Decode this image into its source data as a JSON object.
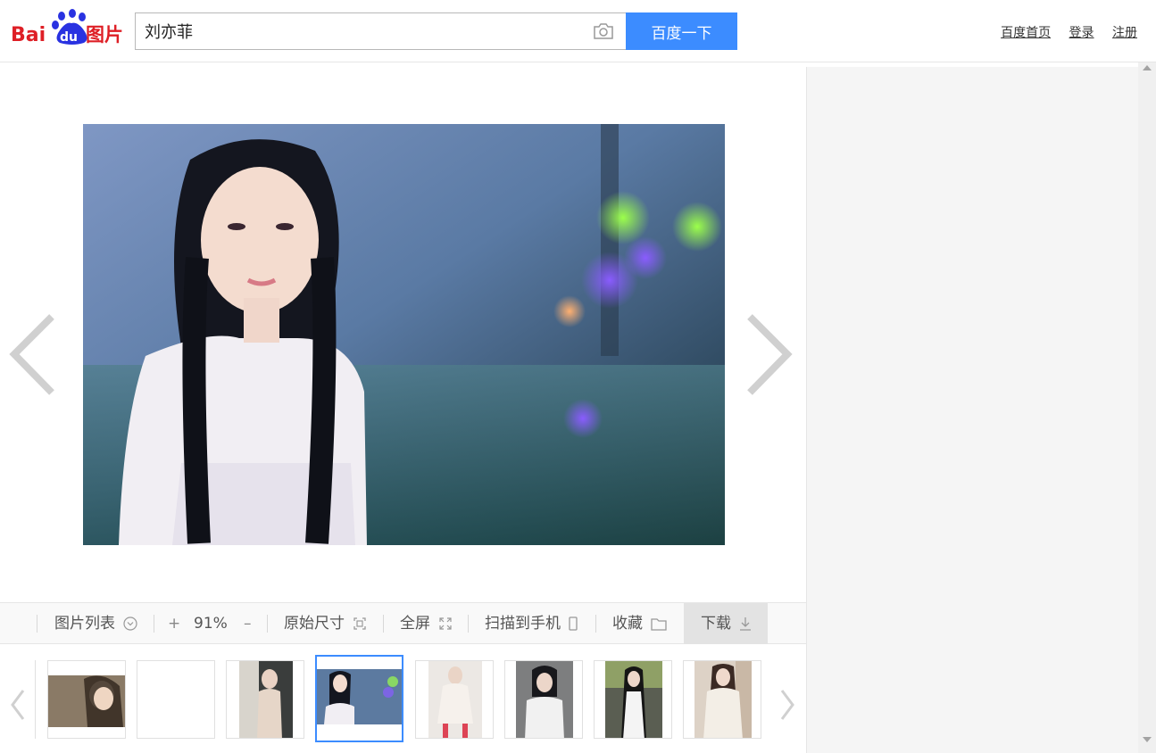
{
  "header": {
    "logo_text_bai": "Bai",
    "logo_text_du": "du",
    "logo_text_pic": "图片",
    "search_value": "刘亦菲",
    "search_button": "百度一下",
    "links": [
      "百度首页",
      "登录",
      "注册"
    ]
  },
  "toolbar": {
    "image_list": "图片列表",
    "zoom_in": "+",
    "zoom_level": "91%",
    "zoom_out": "–",
    "original_size": "原始尺寸",
    "fullscreen": "全屏",
    "scan_to_phone": "扫描到手机",
    "favorite": "收藏",
    "download": "下载"
  },
  "thumbnails": {
    "count": 8,
    "selected_index": 3
  },
  "colors": {
    "accent": "#3c8cff",
    "baidu_red": "#de1f26",
    "baidu_blue": "#2932e1"
  }
}
